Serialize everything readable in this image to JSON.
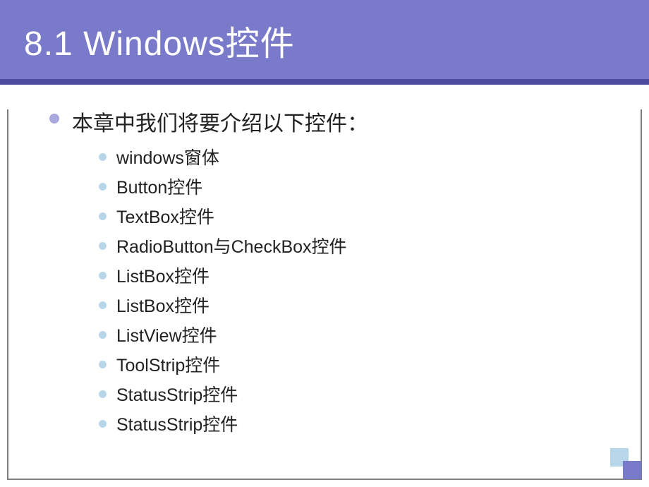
{
  "title": "8.1 Windows控件",
  "main_text": "本章中我们将要介绍以下控件：",
  "items": [
    "windows窗体",
    "Button控件",
    "TextBox控件",
    "RadioButton与CheckBox控件",
    "ListBox控件",
    "ListBox控件",
    "ListView控件",
    "ToolStrip控件",
    "StatusStrip控件",
    "StatusStrip控件"
  ]
}
